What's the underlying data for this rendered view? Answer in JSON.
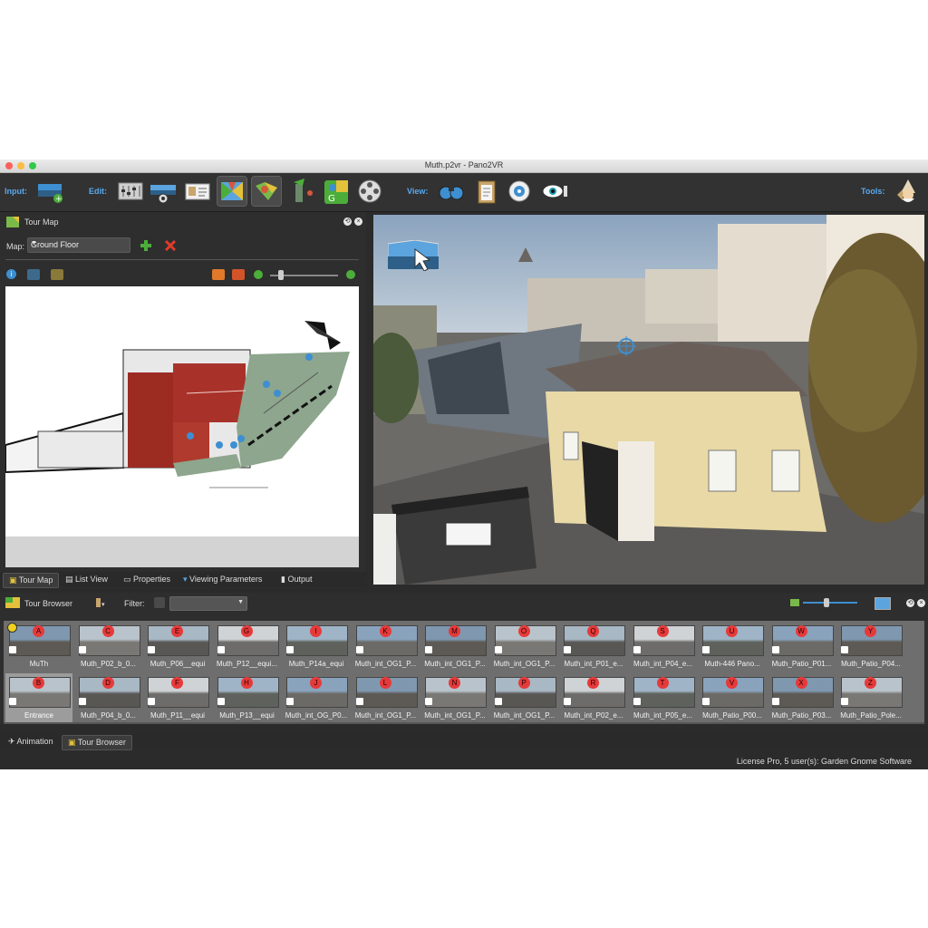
{
  "window": {
    "title": "Muth.p2vr - Pano2VR"
  },
  "toolbar": {
    "input_label": "Input:",
    "edit_label": "Edit:",
    "view_label": "View:",
    "tools_label": "Tools:",
    "icons": [
      "add-panorama-icon",
      "levels-icon",
      "viewing-parameters-icon",
      "properties-card-icon",
      "tour-map-icon",
      "map-editor-icon",
      "patch-icon",
      "google-street-view-icon",
      "animation-film-reel-icon",
      "binoculars-icon",
      "clipboard-icon",
      "gyroscope-icon",
      "eye-icon",
      "gnome-icon"
    ]
  },
  "tour_map_panel": {
    "title": "Tour Map",
    "map_label": "Map:",
    "map_selected": "Ground Floor",
    "tabs": [
      "Tour Map",
      "List View",
      "Properties",
      "Viewing Parameters",
      "Output"
    ],
    "active_tab": "Tour Map"
  },
  "tour_browser": {
    "title": "Tour Browser",
    "filter_label": "Filter:",
    "items": [
      {
        "letter": "A",
        "label": "MuTh"
      },
      {
        "letter": "C",
        "label": "Muth_P02_b_0..."
      },
      {
        "letter": "E",
        "label": "Muth_P06__equi"
      },
      {
        "letter": "G",
        "label": "Muth_P12__equi..."
      },
      {
        "letter": "I",
        "label": "Muth_P14a_equi"
      },
      {
        "letter": "K",
        "label": "Muth_int_OG1_P..."
      },
      {
        "letter": "M",
        "label": "Muth_int_OG1_P..."
      },
      {
        "letter": "O",
        "label": "Muth_int_OG1_P..."
      },
      {
        "letter": "Q",
        "label": "Muth_int_P01_e..."
      },
      {
        "letter": "S",
        "label": "Muth_int_P04_e..."
      },
      {
        "letter": "U",
        "label": "Muth-446 Pano..."
      },
      {
        "letter": "W",
        "label": "Muth_Patio_P01..."
      },
      {
        "letter": "Y",
        "label": "Muth_Patio_P04..."
      },
      {
        "letter": "B",
        "label": "Entrance"
      },
      {
        "letter": "D",
        "label": "Muth_P04_b_0..."
      },
      {
        "letter": "F",
        "label": "Muth_P11__equi"
      },
      {
        "letter": "H",
        "label": "Muth_P13__equi"
      },
      {
        "letter": "J",
        "label": "Muth_int_OG_P0..."
      },
      {
        "letter": "L",
        "label": "Muth_int_OG1_P..."
      },
      {
        "letter": "N",
        "label": "Muth_int_OG1_P..."
      },
      {
        "letter": "P",
        "label": "Muth_int_OG1_P..."
      },
      {
        "letter": "R",
        "label": "Muth_int_P02_e..."
      },
      {
        "letter": "T",
        "label": "Muth_int_P05_e..."
      },
      {
        "letter": "V",
        "label": "Muth_Patio_P00..."
      },
      {
        "letter": "X",
        "label": "Muth_Patio_P03..."
      },
      {
        "letter": "Z",
        "label": "Muth_Patio_Pole..."
      }
    ],
    "selected": "Entrance"
  },
  "bottom_tabs": [
    "Animation",
    "Tour Browser"
  ],
  "bottom_active": "Tour Browser",
  "status": {
    "license": "License Pro, 5 user(s): Garden Gnome Software"
  },
  "colors": {
    "accent_blue": "#58a9f0",
    "badge_red": "#e63a3a",
    "window_bg": "#2b2b2b"
  }
}
